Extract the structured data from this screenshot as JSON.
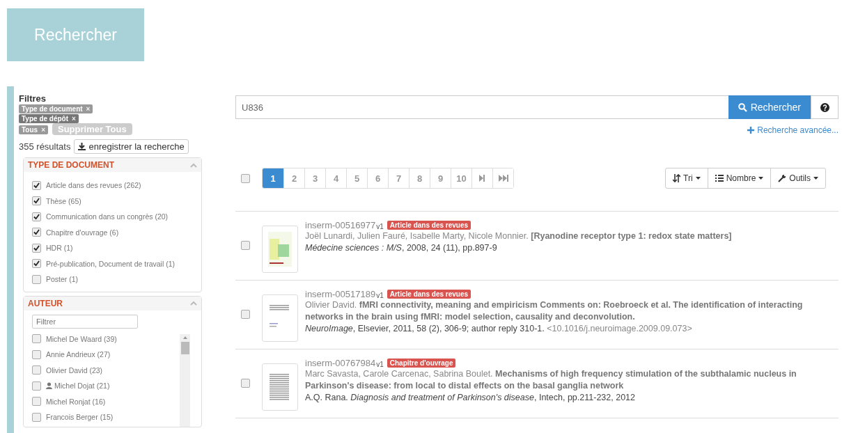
{
  "header": {
    "title": "Rechercher"
  },
  "filters": {
    "title": "Filtres",
    "tags": [
      {
        "label": "Type de document",
        "close": "×",
        "kind": "light"
      },
      {
        "label": "Type de dépôt",
        "close": "×",
        "kind": "dark"
      },
      {
        "label": "Tous",
        "close": "×",
        "kind": "light"
      }
    ],
    "clear_all": "Supprimer Tous",
    "result_count": "355 résultats",
    "save_search": "enregistrer la recherche"
  },
  "facets": [
    {
      "title": "TYPE DE DOCUMENT",
      "expanded": true,
      "items": [
        {
          "label": "Article dans des revues",
          "count": "(262)",
          "checked": true
        },
        {
          "label": "Thèse",
          "count": "(65)",
          "checked": true
        },
        {
          "label": "Communication dans un congrès",
          "count": "(20)",
          "checked": true
        },
        {
          "label": "Chapitre d'ouvrage",
          "count": "(6)",
          "checked": true
        },
        {
          "label": "HDR",
          "count": "(1)",
          "checked": true
        },
        {
          "label": "Pré-publication, Document de travail",
          "count": "(1)",
          "checked": true
        },
        {
          "label": "Poster",
          "count": "(1)",
          "checked": false
        }
      ]
    },
    {
      "title": "AUTEUR",
      "expanded": true,
      "filter_placeholder": "Filtrer",
      "items": [
        {
          "label": "Michel De Waard",
          "count": "(39)",
          "checked": false,
          "profile": false
        },
        {
          "label": "Annie Andrieux",
          "count": "(27)",
          "checked": false,
          "profile": false
        },
        {
          "label": "Olivier David",
          "count": "(23)",
          "checked": false,
          "profile": false
        },
        {
          "label": "Michel Dojat",
          "count": "(21)",
          "checked": false,
          "profile": true
        },
        {
          "label": "Michel Ronjat",
          "count": "(16)",
          "checked": false,
          "profile": false
        },
        {
          "label": "Francois Berger",
          "count": "(15)",
          "checked": false,
          "profile": false
        }
      ]
    }
  ],
  "search": {
    "value": "U836",
    "button": "Rechercher",
    "advanced": "Recherche avancée..."
  },
  "select_all": {
    "checked": false
  },
  "pagination": [
    {
      "label": "1",
      "kind": "page",
      "selected": true
    },
    {
      "label": "2",
      "kind": "page",
      "selected": false
    },
    {
      "label": "3",
      "kind": "page",
      "selected": false
    },
    {
      "label": "4",
      "kind": "page",
      "selected": false
    },
    {
      "label": "5",
      "kind": "page",
      "selected": false
    },
    {
      "label": "6",
      "kind": "page",
      "selected": false
    },
    {
      "label": "7",
      "kind": "page",
      "selected": false
    },
    {
      "label": "8",
      "kind": "page",
      "selected": false
    },
    {
      "label": "9",
      "kind": "page",
      "selected": false
    },
    {
      "label": "10",
      "kind": "page",
      "selected": false
    },
    {
      "kind": "next",
      "selected": false
    },
    {
      "kind": "last",
      "selected": false
    }
  ],
  "tools": [
    {
      "label": "Tri",
      "kind": "sort"
    },
    {
      "label": "Nombre",
      "kind": "list"
    },
    {
      "label": "Outils",
      "kind": "wrench"
    }
  ],
  "results": [
    {
      "id": "inserm-00516977",
      "version": "v1",
      "type": "Article dans des revues",
      "checked": false,
      "line1": "Joël Lunardi, Julien Fauré, Isabelle Marty, Nicole Monnier. **[Ryanodine receptor type 1: redox state matters]**",
      "line2": "*Médecine sciences : M/S*, 2008, 24 (11), pp.897-9",
      "kind": "color"
    },
    {
      "id": "inserm-00517189",
      "version": "v1",
      "type": "Article dans des revues",
      "checked": false,
      "line1": "Olivier David. **fMRI connectivity, meaning and empiricism Comments on: Roebroeck et al. The identification of interacting networks in the brain using fMRI: model selection, causality and deconvolution.**",
      "line2": "*NeuroImage*, Elsevier, 2011, 58 (2), 306-9; author reply 310-1.",
      "doi": "<10.1016/j.neuroimage.2009.09.073>",
      "kind": "sparse"
    },
    {
      "id": "inserm-00767984",
      "version": "v1",
      "type": "Chapitre d'ouvrage",
      "checked": false,
      "line1": "Marc Savasta, Carole Carcenac, Sabrina Boulet. **Mechanisms of high frequency stimulation of the subthalamic nucleus in Parkinson's disease: from local to distal effects on the basal ganglia network**",
      "line2": "A.Q. Rana. *Diagnosis and treatment of Parkinson's disease*, Intech, pp.211-232, 2012",
      "kind": "dense"
    }
  ]
}
